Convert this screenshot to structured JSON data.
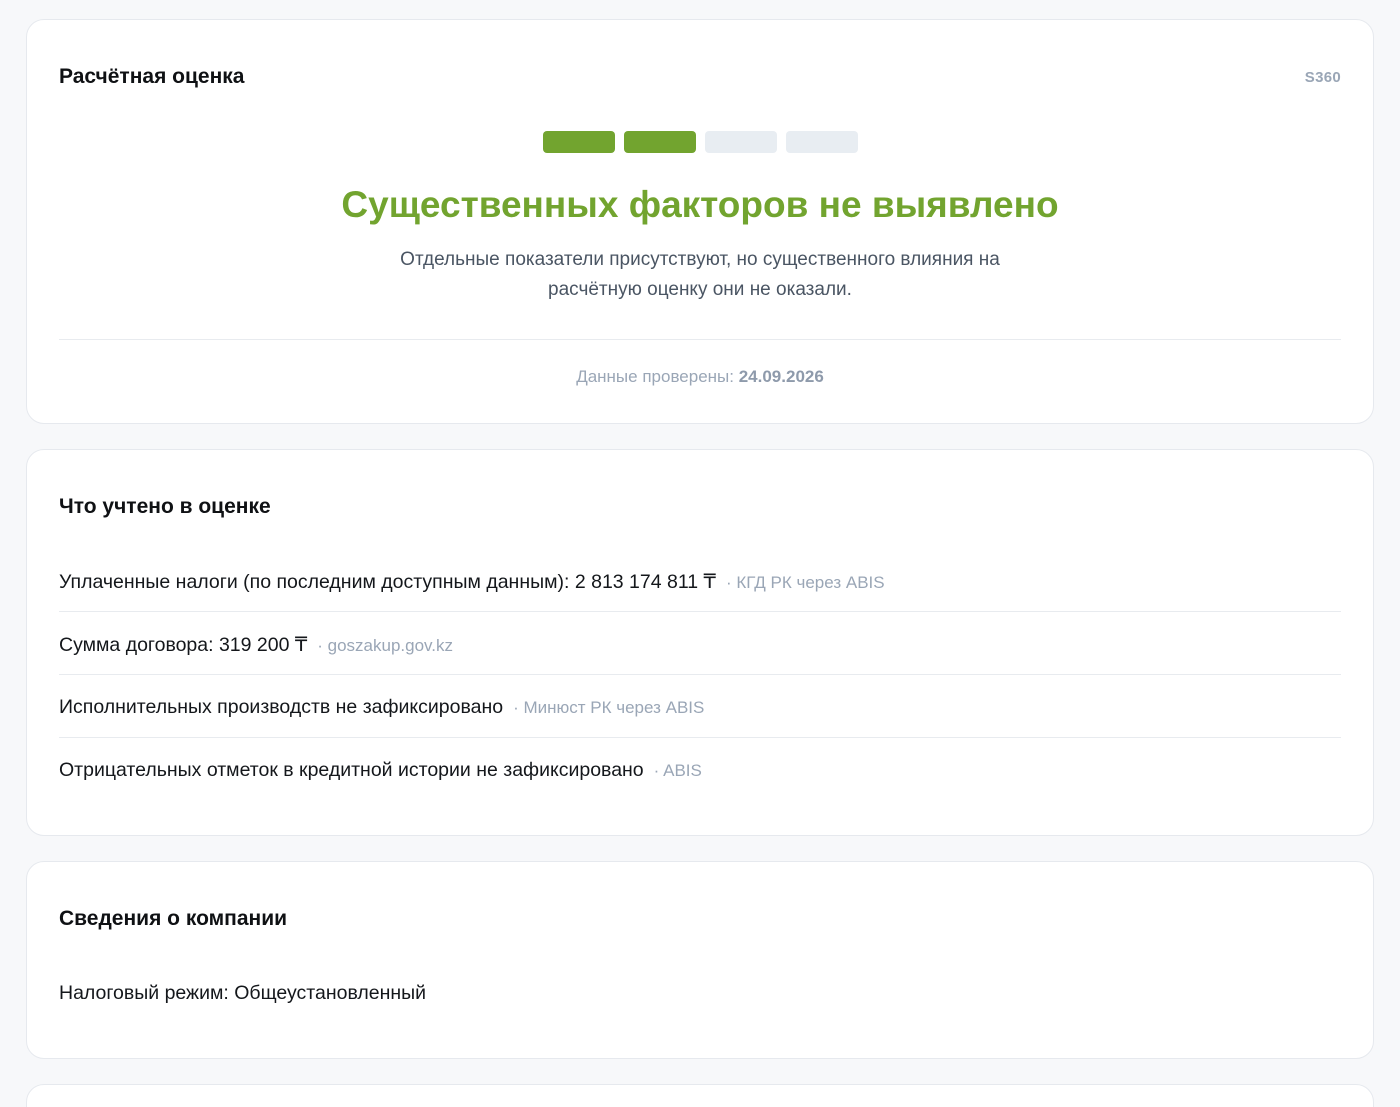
{
  "score_card": {
    "title": "Расчётная оценка",
    "badge": "S360",
    "meter": {
      "filled": 2,
      "total": 4,
      "color": "#72a42f"
    },
    "verdict": "Существенных факторов не выявлено",
    "description": "Отдельные показатели присутствуют, но существенного влияния на расчётную оценку они не оказали.",
    "checked_label": "Данные проверены:",
    "checked_date": "24.09.2026"
  },
  "factors_card": {
    "title": "Что учтено в оценке",
    "items": [
      {
        "text": "Уплаченные налоги (по последним доступным данным): 2 813 174 811 ₸",
        "source": "· КГД РК через ABIS"
      },
      {
        "text": "Сумма договора: 319 200 ₸",
        "source": "· goszakup.gov.kz"
      },
      {
        "text": "Исполнительных производств не зафиксировано",
        "source": "· Минюст РК через ABIS"
      },
      {
        "text": "Отрицательных отметок в кредитной истории не зафиксировано",
        "source": "· ABIS"
      }
    ]
  },
  "company_card": {
    "title": "Сведения о компании",
    "tax_regime": "Налоговый режим: Общеустановленный"
  },
  "colors": {
    "accent_green": "#72a42f",
    "muted_text": "#9aa6b6",
    "background": "#f7f8fa"
  }
}
